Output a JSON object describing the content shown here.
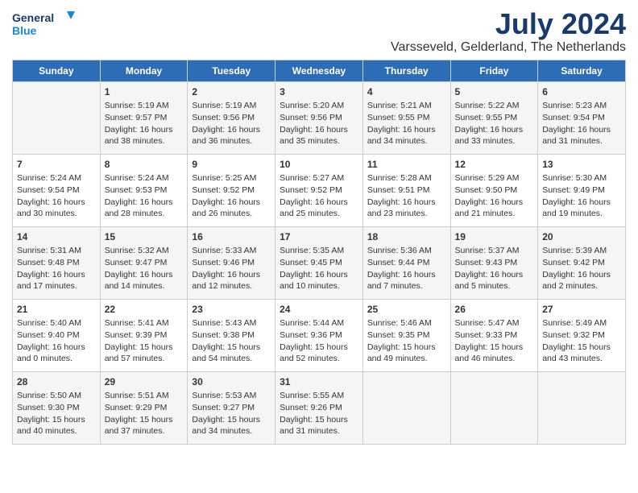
{
  "logo": {
    "line1": "General",
    "line2": "Blue"
  },
  "title": "July 2024",
  "location": "Varsseveld, Gelderland, The Netherlands",
  "headers": [
    "Sunday",
    "Monday",
    "Tuesday",
    "Wednesday",
    "Thursday",
    "Friday",
    "Saturday"
  ],
  "weeks": [
    [
      {
        "day": "",
        "info": ""
      },
      {
        "day": "1",
        "info": "Sunrise: 5:19 AM\nSunset: 9:57 PM\nDaylight: 16 hours\nand 38 minutes."
      },
      {
        "day": "2",
        "info": "Sunrise: 5:19 AM\nSunset: 9:56 PM\nDaylight: 16 hours\nand 36 minutes."
      },
      {
        "day": "3",
        "info": "Sunrise: 5:20 AM\nSunset: 9:56 PM\nDaylight: 16 hours\nand 35 minutes."
      },
      {
        "day": "4",
        "info": "Sunrise: 5:21 AM\nSunset: 9:55 PM\nDaylight: 16 hours\nand 34 minutes."
      },
      {
        "day": "5",
        "info": "Sunrise: 5:22 AM\nSunset: 9:55 PM\nDaylight: 16 hours\nand 33 minutes."
      },
      {
        "day": "6",
        "info": "Sunrise: 5:23 AM\nSunset: 9:54 PM\nDaylight: 16 hours\nand 31 minutes."
      }
    ],
    [
      {
        "day": "7",
        "info": "Sunrise: 5:24 AM\nSunset: 9:54 PM\nDaylight: 16 hours\nand 30 minutes."
      },
      {
        "day": "8",
        "info": "Sunrise: 5:24 AM\nSunset: 9:53 PM\nDaylight: 16 hours\nand 28 minutes."
      },
      {
        "day": "9",
        "info": "Sunrise: 5:25 AM\nSunset: 9:52 PM\nDaylight: 16 hours\nand 26 minutes."
      },
      {
        "day": "10",
        "info": "Sunrise: 5:27 AM\nSunset: 9:52 PM\nDaylight: 16 hours\nand 25 minutes."
      },
      {
        "day": "11",
        "info": "Sunrise: 5:28 AM\nSunset: 9:51 PM\nDaylight: 16 hours\nand 23 minutes."
      },
      {
        "day": "12",
        "info": "Sunrise: 5:29 AM\nSunset: 9:50 PM\nDaylight: 16 hours\nand 21 minutes."
      },
      {
        "day": "13",
        "info": "Sunrise: 5:30 AM\nSunset: 9:49 PM\nDaylight: 16 hours\nand 19 minutes."
      }
    ],
    [
      {
        "day": "14",
        "info": "Sunrise: 5:31 AM\nSunset: 9:48 PM\nDaylight: 16 hours\nand 17 minutes."
      },
      {
        "day": "15",
        "info": "Sunrise: 5:32 AM\nSunset: 9:47 PM\nDaylight: 16 hours\nand 14 minutes."
      },
      {
        "day": "16",
        "info": "Sunrise: 5:33 AM\nSunset: 9:46 PM\nDaylight: 16 hours\nand 12 minutes."
      },
      {
        "day": "17",
        "info": "Sunrise: 5:35 AM\nSunset: 9:45 PM\nDaylight: 16 hours\nand 10 minutes."
      },
      {
        "day": "18",
        "info": "Sunrise: 5:36 AM\nSunset: 9:44 PM\nDaylight: 16 hours\nand 7 minutes."
      },
      {
        "day": "19",
        "info": "Sunrise: 5:37 AM\nSunset: 9:43 PM\nDaylight: 16 hours\nand 5 minutes."
      },
      {
        "day": "20",
        "info": "Sunrise: 5:39 AM\nSunset: 9:42 PM\nDaylight: 16 hours\nand 2 minutes."
      }
    ],
    [
      {
        "day": "21",
        "info": "Sunrise: 5:40 AM\nSunset: 9:40 PM\nDaylight: 16 hours\nand 0 minutes."
      },
      {
        "day": "22",
        "info": "Sunrise: 5:41 AM\nSunset: 9:39 PM\nDaylight: 15 hours\nand 57 minutes."
      },
      {
        "day": "23",
        "info": "Sunrise: 5:43 AM\nSunset: 9:38 PM\nDaylight: 15 hours\nand 54 minutes."
      },
      {
        "day": "24",
        "info": "Sunrise: 5:44 AM\nSunset: 9:36 PM\nDaylight: 15 hours\nand 52 minutes."
      },
      {
        "day": "25",
        "info": "Sunrise: 5:46 AM\nSunset: 9:35 PM\nDaylight: 15 hours\nand 49 minutes."
      },
      {
        "day": "26",
        "info": "Sunrise: 5:47 AM\nSunset: 9:33 PM\nDaylight: 15 hours\nand 46 minutes."
      },
      {
        "day": "27",
        "info": "Sunrise: 5:49 AM\nSunset: 9:32 PM\nDaylight: 15 hours\nand 43 minutes."
      }
    ],
    [
      {
        "day": "28",
        "info": "Sunrise: 5:50 AM\nSunset: 9:30 PM\nDaylight: 15 hours\nand 40 minutes."
      },
      {
        "day": "29",
        "info": "Sunrise: 5:51 AM\nSunset: 9:29 PM\nDaylight: 15 hours\nand 37 minutes."
      },
      {
        "day": "30",
        "info": "Sunrise: 5:53 AM\nSunset: 9:27 PM\nDaylight: 15 hours\nand 34 minutes."
      },
      {
        "day": "31",
        "info": "Sunrise: 5:55 AM\nSunset: 9:26 PM\nDaylight: 15 hours\nand 31 minutes."
      },
      {
        "day": "",
        "info": ""
      },
      {
        "day": "",
        "info": ""
      },
      {
        "day": "",
        "info": ""
      }
    ]
  ]
}
